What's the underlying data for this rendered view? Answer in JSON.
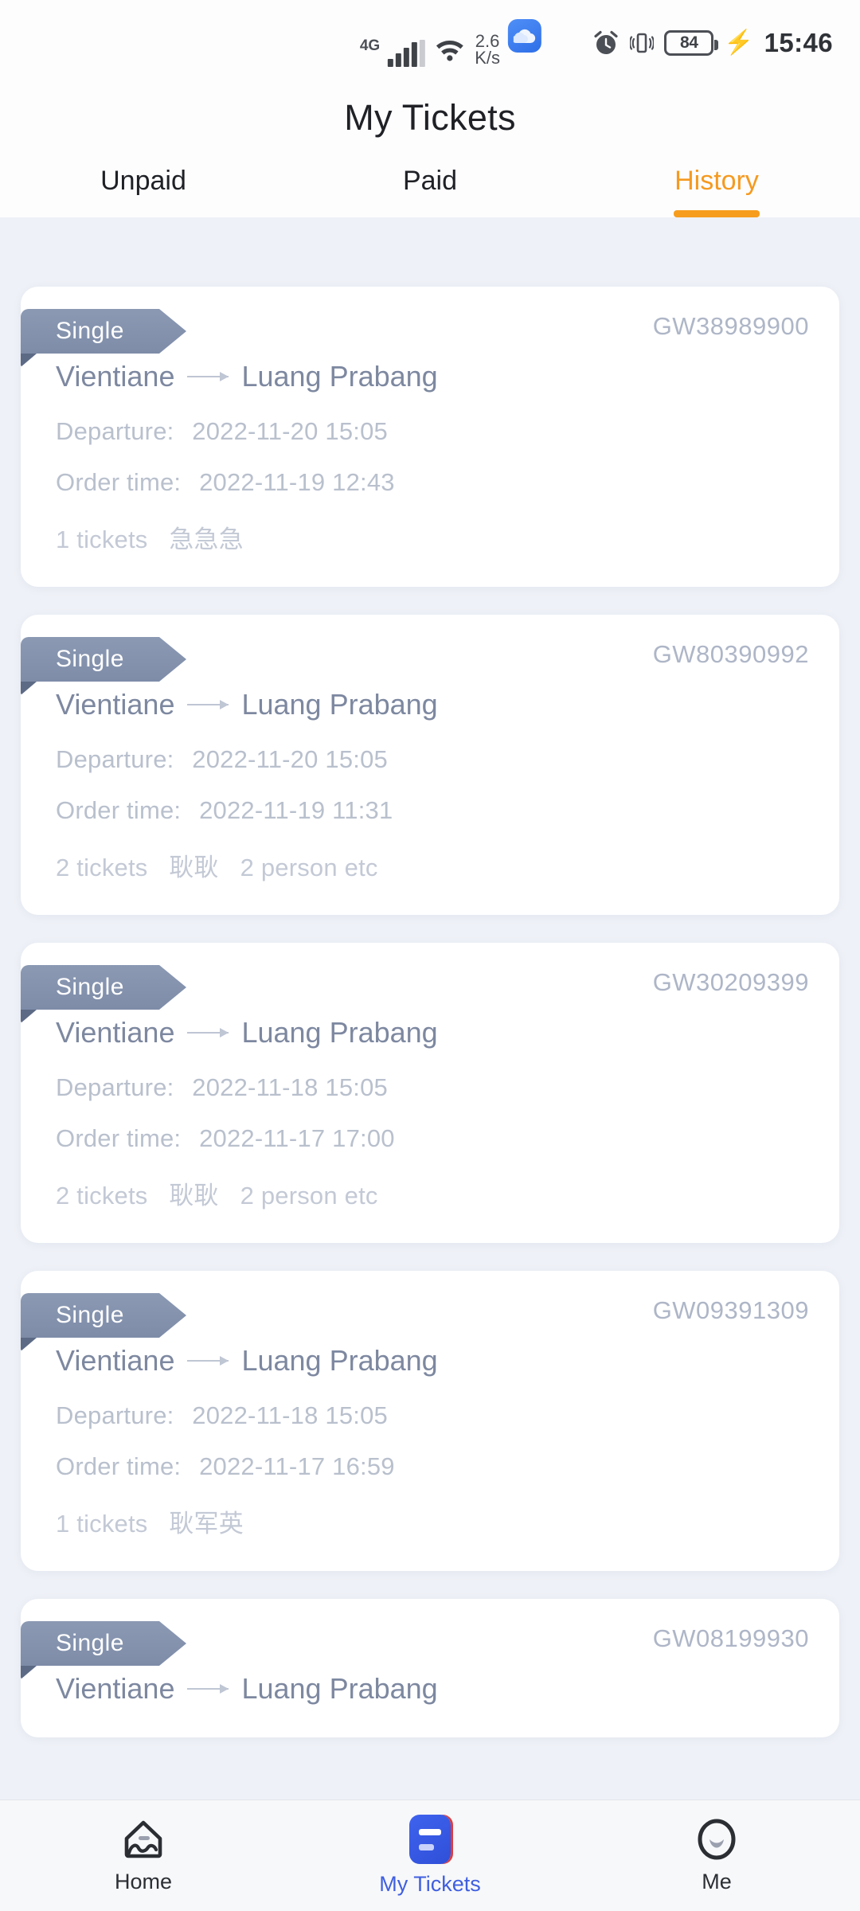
{
  "statusbar": {
    "network_type": "4G",
    "speed_value": "2.6",
    "speed_unit": "K/s",
    "battery_level": "84",
    "time": "15:46",
    "icons": [
      "signal-icon",
      "wifi-icon",
      "cloud-app-icon",
      "alarm-clock-icon",
      "vibrate-icon",
      "battery-icon",
      "charging-bolt-icon"
    ]
  },
  "header": {
    "title": "My Tickets"
  },
  "tabs": [
    {
      "label": "Unpaid",
      "active": false
    },
    {
      "label": "Paid",
      "active": false
    },
    {
      "label": "History",
      "active": true
    }
  ],
  "labels": {
    "departure": "Departure:",
    "order_time": "Order time:"
  },
  "colors": {
    "accent_orange": "#f79d1e",
    "ribbon_gray": "#8b99b3",
    "nav_active_blue": "#3f5fe0",
    "page_background": "#eef1f7",
    "card_background": "#ffffff",
    "route_text": "#7d88a0",
    "meta_text": "#b9c0cd"
  },
  "tickets": [
    {
      "type": "Single",
      "order_no": "GW38989900",
      "from": "Vientiane",
      "to": "Luang Prabang",
      "departure": "2022-11-20 15:05",
      "order_time": "2022-11-19 12:43",
      "ticket_count": "1 tickets",
      "passenger": "急急急",
      "extra": ""
    },
    {
      "type": "Single",
      "order_no": "GW80390992",
      "from": "Vientiane",
      "to": "Luang Prabang",
      "departure": "2022-11-20 15:05",
      "order_time": "2022-11-19 11:31",
      "ticket_count": "2 tickets",
      "passenger": "耿耿",
      "extra": "2 person etc"
    },
    {
      "type": "Single",
      "order_no": "GW30209399",
      "from": "Vientiane",
      "to": "Luang Prabang",
      "departure": "2022-11-18 15:05",
      "order_time": "2022-11-17 17:00",
      "ticket_count": "2 tickets",
      "passenger": "耿耿",
      "extra": "2 person etc"
    },
    {
      "type": "Single",
      "order_no": "GW09391309",
      "from": "Vientiane",
      "to": "Luang Prabang",
      "departure": "2022-11-18 15:05",
      "order_time": "2022-11-17 16:59",
      "ticket_count": "1 tickets",
      "passenger": "耿军英",
      "extra": ""
    },
    {
      "type": "Single",
      "order_no": "GW08199930",
      "from": "Vientiane",
      "to": "Luang Prabang",
      "departure": "",
      "order_time": "",
      "ticket_count": "",
      "passenger": "",
      "extra": ""
    }
  ],
  "bottom_nav": [
    {
      "label": "Home",
      "icon": "home-icon",
      "active": false
    },
    {
      "label": "My Tickets",
      "icon": "ticket-icon",
      "active": true
    },
    {
      "label": "Me",
      "icon": "profile-icon",
      "active": false
    }
  ]
}
